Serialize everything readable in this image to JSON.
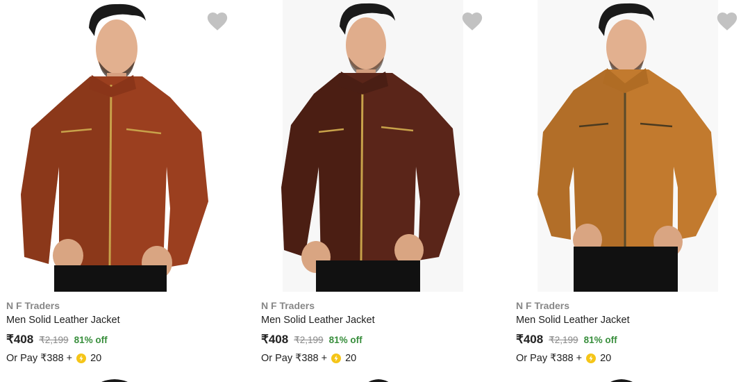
{
  "products": [
    {
      "brand": "N F Traders",
      "title": "Men Solid Leather Jacket",
      "price": "₹408",
      "mrp": "₹2,199",
      "discount": "81% off",
      "pay_text": "Or Pay ₹388 +",
      "coins": "20",
      "jacket_color": "#9b3f1f",
      "jacket_shade": "#6e2a12",
      "wishlist_icon": "heart-icon"
    },
    {
      "brand": "N F Traders",
      "title": "Men Solid Leather Jacket",
      "price": "₹408",
      "mrp": "₹2,199",
      "discount": "81% off",
      "pay_text": "Or Pay ₹388 +",
      "coins": "20",
      "jacket_color": "#5a2519",
      "jacket_shade": "#3a160e",
      "wishlist_icon": "heart-icon"
    },
    {
      "brand": "N F Traders",
      "title": "Men Solid Leather Jacket",
      "price": "₹408",
      "mrp": "₹2,199",
      "discount": "81% off",
      "pay_text": "Or Pay ₹388 +",
      "coins": "20",
      "jacket_color": "#c27a2e",
      "jacket_shade": "#8e5419",
      "wishlist_icon": "heart-icon"
    }
  ],
  "colors": {
    "brand_text": "#878787",
    "discount_green": "#388e3c",
    "coin_yellow": "#f5c518",
    "wishlist_grey": "#c2c2c2"
  }
}
